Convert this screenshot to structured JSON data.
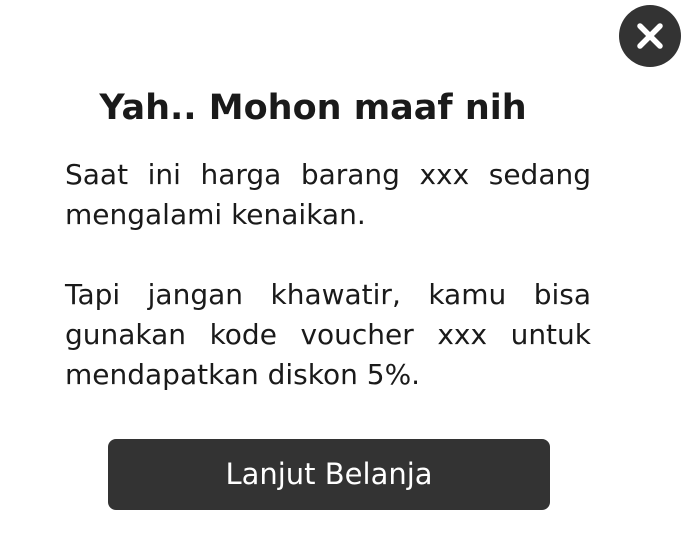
{
  "dialog": {
    "title": "Yah.. Mohon maaf nih",
    "paragraph_1": "Saat ini harga barang xxx sedang mengalami kenaikan.",
    "paragraph_2": "Tapi jangan khawatir, kamu bisa gunakan kode voucher xxx untuk mendapatkan diskon 5%.",
    "continue_label": "Lanjut Belanja",
    "close_icon": "close-icon"
  },
  "colors": {
    "background": "#ffffff",
    "text": "#1a1a1a",
    "button": "#333333",
    "button_text": "#ffffff"
  }
}
